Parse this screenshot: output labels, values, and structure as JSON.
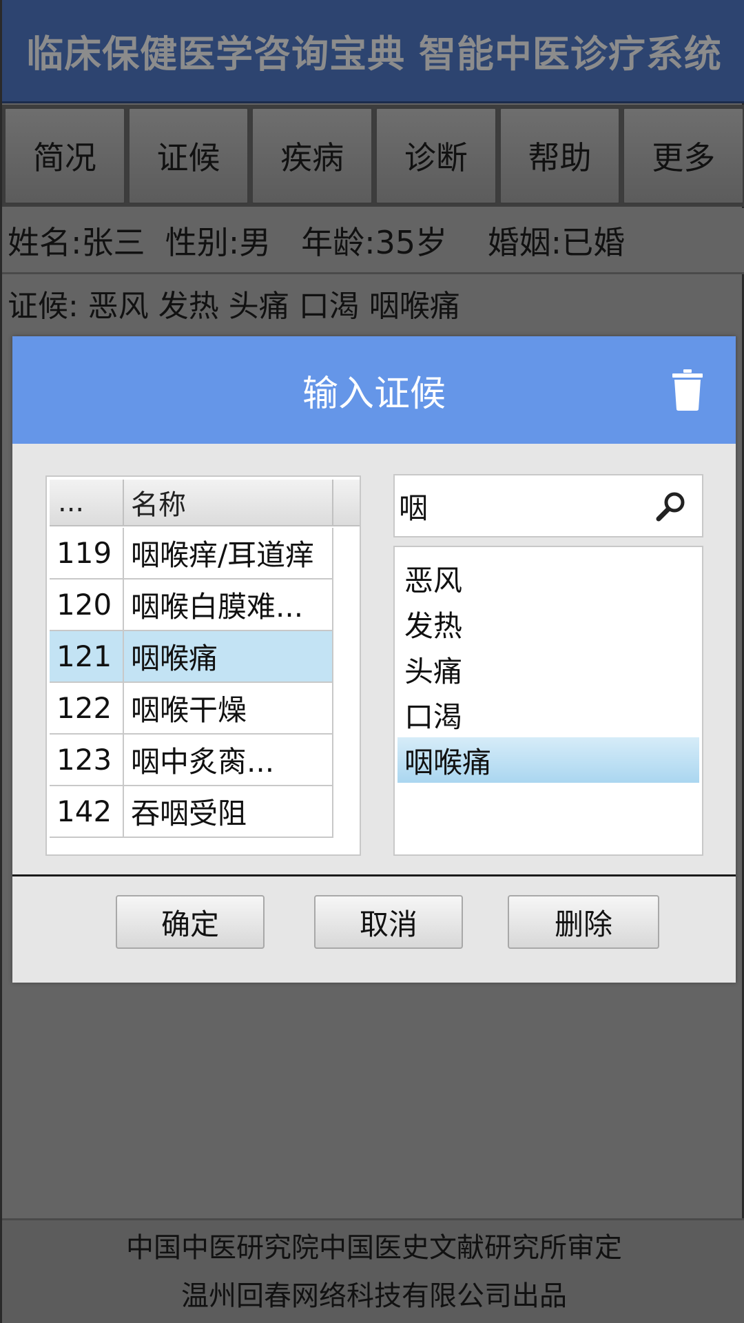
{
  "header": {
    "title": "临床保健医学咨询宝典 智能中医诊疗系统"
  },
  "tabs": [
    {
      "label": "简况"
    },
    {
      "label": "证候"
    },
    {
      "label": "疾病"
    },
    {
      "label": "诊断"
    },
    {
      "label": "帮助"
    },
    {
      "label": "更多"
    }
  ],
  "patient": {
    "text": "姓名:张三  性别:男   年龄:35岁    婚姻:已婚"
  },
  "syndromes": {
    "text": "证候: 恶风 发热 头痛 口渴 咽喉痛"
  },
  "dialog": {
    "title": "输入证候",
    "icons": {
      "delete": "trash-icon",
      "search": "search-icon"
    },
    "grid": {
      "headers": {
        "num": "...",
        "name": "名称"
      },
      "rows": [
        {
          "num": "119",
          "name": "咽喉痒/耳道痒",
          "selected": false
        },
        {
          "num": "120",
          "name": "咽喉白膜难...",
          "selected": false
        },
        {
          "num": "121",
          "name": "咽喉痛",
          "selected": true
        },
        {
          "num": "122",
          "name": "咽喉干燥",
          "selected": false
        },
        {
          "num": "123",
          "name": "咽中炙脔...",
          "selected": false
        },
        {
          "num": "142",
          "name": "吞咽受阻",
          "selected": false
        }
      ]
    },
    "search": {
      "value": "咽",
      "placeholder": ""
    },
    "selected_items": [
      {
        "label": "恶风",
        "selected": false
      },
      {
        "label": "发热",
        "selected": false
      },
      {
        "label": "头痛",
        "selected": false
      },
      {
        "label": "口渴",
        "selected": false
      },
      {
        "label": "咽喉痛",
        "selected": true
      }
    ],
    "buttons": {
      "ok": "确定",
      "cancel": "取消",
      "delete": "删除"
    }
  },
  "footer": {
    "line1": "中国中医研究院中国医史文献研究所审定",
    "line2": "温州回春网络科技有限公司出品"
  },
  "colors": {
    "header_bg": "#2d4470",
    "dialog_header_bg": "#6596e8",
    "selection_bg": "#c3e3f4"
  }
}
